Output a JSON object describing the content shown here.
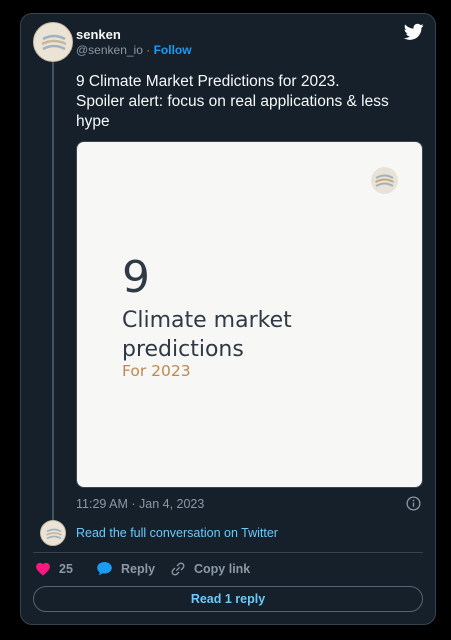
{
  "tweet": {
    "author_name": "senken",
    "handle": "@senken_io",
    "separator": "·",
    "follow_label": "Follow",
    "text_lines": [
      "9 Climate Market Predictions for 2023.",
      "Spoiler alert: focus on real applications & less",
      "hype"
    ],
    "timestamp": "11:29 AM · Jan 4, 2023"
  },
  "media": {
    "number": "9",
    "title_lines": [
      "Climate market",
      "predictions"
    ],
    "subtitle": "For 2023",
    "accent_color": "#c08850"
  },
  "conversation": {
    "read_full_label": "Read the full conversation on Twitter"
  },
  "actions": {
    "like_count": "25",
    "reply_label": "Reply",
    "copy_link_label": "Copy link",
    "read_reply_label": "Read 1 reply"
  },
  "colors": {
    "background": "#000000",
    "card": "#15202b",
    "link": "#1d9bf0",
    "like": "#f91880",
    "reply": "#1d9bf0"
  },
  "icons": {
    "brand": "twitter-bird-icon",
    "info": "info-icon",
    "like": "heart-icon",
    "reply": "speech-bubble-icon",
    "copy": "link-icon"
  }
}
